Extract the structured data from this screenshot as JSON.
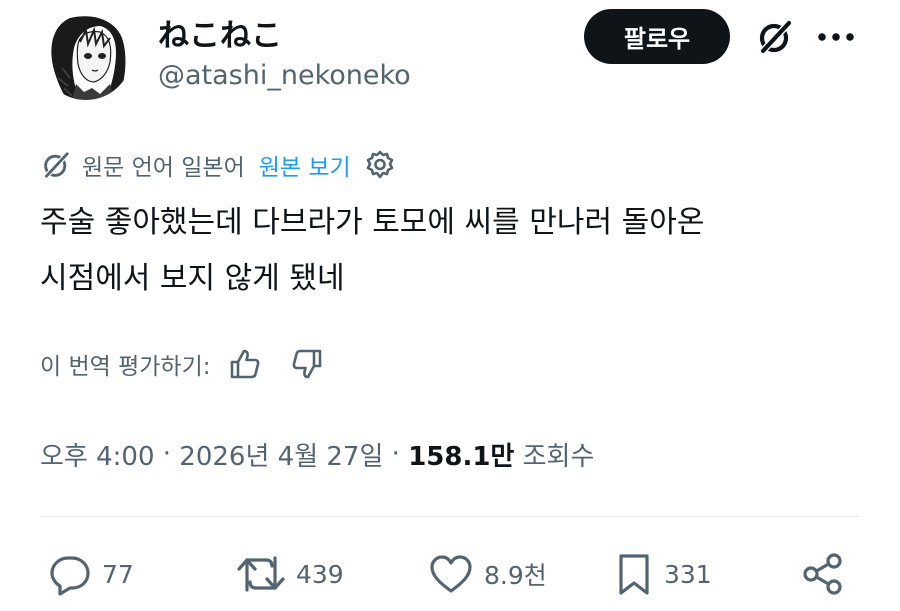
{
  "user": {
    "display_name": "ねこねこ",
    "handle": "@atashi_nekoneko"
  },
  "header": {
    "follow_label": "팔로우",
    "grok_icon": "grok-icon",
    "more_icon": "more-icon"
  },
  "translation": {
    "source_language_text": "원문 언어 일본어",
    "view_original_label": "원본 보기"
  },
  "tweet": {
    "text_line_1": "주술 좋아했는데 다브라가 토모에 씨를 만나러 돌아온",
    "text_line_2": "시점에서 보지 않게 됐네"
  },
  "rating": {
    "label": "이 번역 평가하기:"
  },
  "meta": {
    "time": "오후 4:00",
    "sep1": " · ",
    "date": "2026년 4월 27일",
    "sep2": " · ",
    "views_count": "158.1만",
    "views_label": " 조회수"
  },
  "actions": {
    "replies": "77",
    "reposts": "439",
    "likes": "8.9천",
    "bookmarks": "331"
  },
  "colors": {
    "text_primary": "#0f1419",
    "text_secondary": "#536471",
    "link": "#1d9bf0",
    "follow_button_bg": "#0f1419",
    "divider": "#e6e9ea"
  }
}
